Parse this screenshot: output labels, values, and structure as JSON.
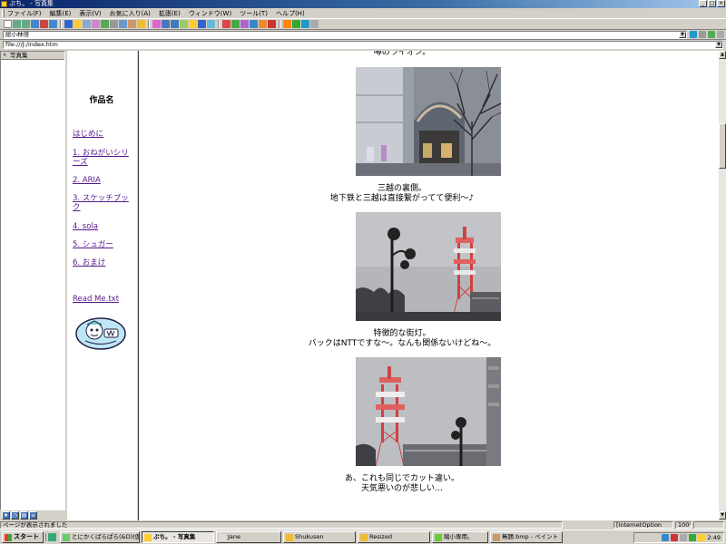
{
  "window": {
    "title": "ぷち。 - 写真集",
    "min": "_",
    "max": "□",
    "close": "×"
  },
  "menu": [
    "ファイル(F)",
    "編集(E)",
    "表示(V)",
    "お気に入り(A)",
    "拡張(E)",
    "ウィンドウ(W)",
    "ツール(T)",
    "ヘルプ(H)"
  ],
  "address": {
    "label": "総小林倍",
    "url": "file:///J:/index.htm"
  },
  "favorites": {
    "header": "写真集"
  },
  "nav": {
    "title": "作品名",
    "links": [
      {
        "label": "はじめに"
      },
      {
        "label": "1. おねがいシリーズ"
      },
      {
        "label": "2. ARIA"
      },
      {
        "label": "3. スケッチブック"
      },
      {
        "label": "4. sola"
      },
      {
        "label": "5. シュガー"
      },
      {
        "label": "6. おまけ"
      },
      {
        "label": "Read Me.txt"
      }
    ]
  },
  "content": {
    "captions": [
      {
        "lines": [
          "噂のライオン。"
        ]
      },
      {
        "lines": [
          "三越の裏側。",
          "地下鉄と三越は直接繋がってて便利～♪"
        ]
      },
      {
        "lines": [
          "特徴的な街灯。",
          "バックはNTTですな～。なんも関係ないけどね～。"
        ]
      },
      {
        "lines": [
          "あ、これも同じでカット違い。",
          "天気悪いのが悲しい…"
        ]
      }
    ]
  },
  "status": {
    "text": "ページが表示されました",
    "zone": "[InternetOption",
    "zoom": "100%"
  },
  "taskbar": {
    "start": "スタート",
    "tasks": [
      {
        "label": "とにかくぱらぱら(&D)(仮)",
        "active": false
      },
      {
        "label": "ぷち。 - 写真集",
        "active": true
      },
      {
        "label": "Jane",
        "active": false
      },
      {
        "label": "Shukusen",
        "active": false
      },
      {
        "label": "Resized",
        "active": false
      },
      {
        "label": "縮小専用。",
        "active": false
      },
      {
        "label": "無題.bmp - ペイント",
        "active": false
      }
    ],
    "clock": "2:49"
  }
}
